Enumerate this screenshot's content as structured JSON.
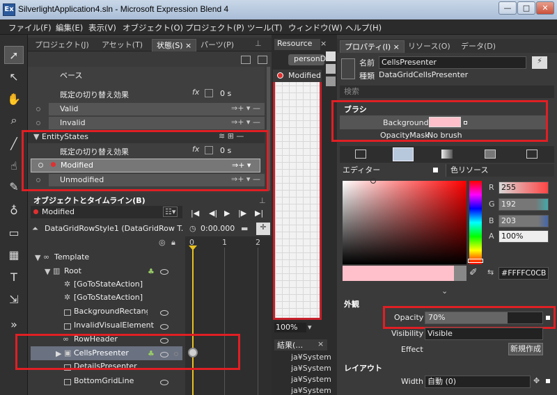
{
  "window": {
    "title": "SilverlightApplication4.sln - Microsoft Expression Blend 4",
    "app_icon": "Ex"
  },
  "menu": [
    "ファイル(F)",
    "編集(E)",
    "表示(V)",
    "オブジェクト(O)",
    "プロジェクト(P)",
    "ツール(T)",
    "ウィンドウ(W)",
    "ヘルプ(H)"
  ],
  "left_tabs": [
    "プロジェクト(J)",
    "アセット(T)",
    "状態(S) ×",
    "パーツ(P)"
  ],
  "states": {
    "group1_name": "ベース",
    "transition_label": "既定の切り替え効果",
    "transition_time": "0 s",
    "valid": "Valid",
    "invalid": "Invalid",
    "group2_name": "EntityStates",
    "transition_label2": "既定の切り替え効果",
    "transition_time2": "0 s",
    "modified": "Modified",
    "unmodified": "Unmodified"
  },
  "objects": {
    "header": "オブジェクトとタイムライン(B)",
    "state_label": "Modified",
    "breadcrumb": "DataGridRowStyle1 (DataGridRow T...",
    "time": "0:00.000",
    "ruler": [
      "0",
      "1",
      "2"
    ],
    "tree": [
      "Template",
      "Root",
      "[GoToStateAction]",
      "[GoToStateAction]",
      "BackgroundRectangle",
      "InvalidVisualElement",
      "RowHeader",
      "CellsPresenter",
      "DetailsPresenter",
      "BottomGridLine"
    ]
  },
  "center": {
    "tab": "Resource",
    "doc_tab": "personD",
    "state_badge": "Modified",
    "zoom": "100%",
    "results_tab": "結果(…",
    "results": [
      "ja¥System",
      "ja¥System",
      "ja¥System",
      "ja¥System"
    ]
  },
  "right_tabs": [
    "プロパティ(I) ×",
    "リソース(O)",
    "データ(D)"
  ],
  "properties": {
    "name_label": "名前",
    "name_value": "CellsPresenter",
    "type_label": "種類",
    "type_value": "DataGridCellsPresenter",
    "search_placeholder": "検索",
    "brush_section": "ブラシ",
    "background_label": "Background",
    "opacitymask_label": "OpacityMask",
    "opacitymask_value": "No brush",
    "editor_tab": "エディター",
    "color_resources_tab": "色リソース",
    "r_label": "R",
    "r_value": "255",
    "g_label": "G",
    "g_value": "192",
    "b_label": "B",
    "b_value": "203",
    "a_label": "A",
    "a_value": "100%",
    "hex_value": "#FFFFC0CB",
    "appearance_section": "外観",
    "opacity_label": "Opacity",
    "opacity_value": "70%",
    "opacity_level": 0.7,
    "visibility_label": "Visibility",
    "visibility_value": "Visible",
    "effect_label": "Effect",
    "new_button": "新規作成",
    "layout_section": "レイアウト",
    "width_label": "Width",
    "width_value": "自動 (0)",
    "background_color": "#FFC0CB"
  }
}
